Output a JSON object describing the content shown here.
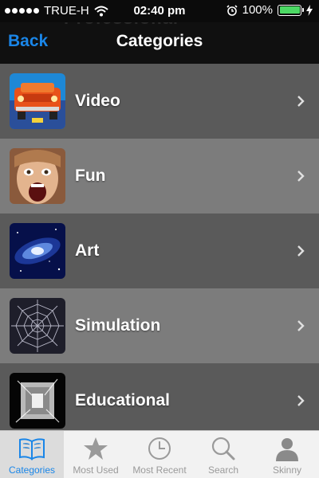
{
  "status_bar": {
    "carrier": "TRUE-H",
    "time": "02:40 pm",
    "battery": "100%",
    "battery_level": 1.0,
    "battery_color": "#4cd964"
  },
  "nav": {
    "ghost_text": "Professional",
    "back_label": "Back",
    "title": "Categories",
    "back_color": "#1a86e8"
  },
  "categories": [
    {
      "label": "Video",
      "icon": "car-thumbnail"
    },
    {
      "label": "Fun",
      "icon": "screaming-face-thumbnail"
    },
    {
      "label": "Art",
      "icon": "galaxy-thumbnail"
    },
    {
      "label": "Simulation",
      "icon": "spider-web-thumbnail"
    },
    {
      "label": "Educational",
      "icon": "sketch-thumbnail"
    }
  ],
  "tab_bar": {
    "tabs": [
      {
        "label": "Categories",
        "icon": "book-icon",
        "active": true
      },
      {
        "label": "Most Used",
        "icon": "star-icon",
        "active": false
      },
      {
        "label": "Most Recent",
        "icon": "clock-icon",
        "active": false
      },
      {
        "label": "Search",
        "icon": "search-icon",
        "active": false
      },
      {
        "label": "Skinny",
        "icon": "person-icon",
        "active": false
      }
    ]
  }
}
